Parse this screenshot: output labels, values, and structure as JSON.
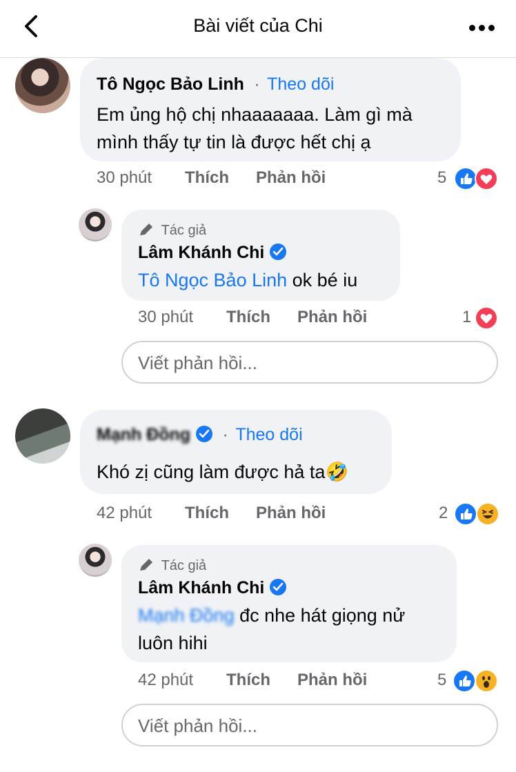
{
  "header": {
    "title": "Bài viết của Chi"
  },
  "comments": [
    {
      "name": "Tô Ngọc Bảo Linh",
      "follow": "Theo dõi",
      "separator": "·",
      "text_line1": "Em ủng hộ chị nhaaaaaaa. Làm gì mà",
      "text_line2": "mình thấy tự tin là được hết chị ạ",
      "time": "30 phút",
      "like": "Thích",
      "reply": "Phản hồi",
      "reaction_count": "5",
      "reactions": [
        "like-icon",
        "heart-icon"
      ]
    },
    {
      "author_tag": "Tác giả",
      "name": "Lâm Khánh Chi",
      "mention": "Tô Ngọc Bảo Linh",
      "text": " ok bé iu",
      "time": "30 phút",
      "like": "Thích",
      "reply": "Phản hồi",
      "reaction_count": "1",
      "reactions": [
        "heart-icon"
      ]
    },
    {
      "name": "Mạnh Đồng",
      "follow": "Theo dõi",
      "separator": "·",
      "text": "Khó zị cũng làm được hả ta",
      "emoji": "🤣",
      "time": "42 phút",
      "like": "Thích",
      "reply": "Phản hồi",
      "reaction_count": "2",
      "reactions": [
        "like-icon",
        "laugh-icon"
      ]
    },
    {
      "author_tag": "Tác giả",
      "name": "Lâm Khánh Chi",
      "mention": "Mạnh Đồng",
      "text_line1": " đc nhe hát giọng nử",
      "text_line2": "luôn hihi",
      "time": "42 phút",
      "like": "Thích",
      "reply": "Phản hồi",
      "reaction_count": "5",
      "reactions": [
        "like-icon",
        "wow-icon"
      ]
    }
  ],
  "reply_box": {
    "placeholder": "Viết phản hồi..."
  },
  "colors": {
    "link_blue": "#1877f2",
    "bubble_gray": "#f0f2f5",
    "meta_gray": "#65676b",
    "heart_red": "#f33e58"
  }
}
